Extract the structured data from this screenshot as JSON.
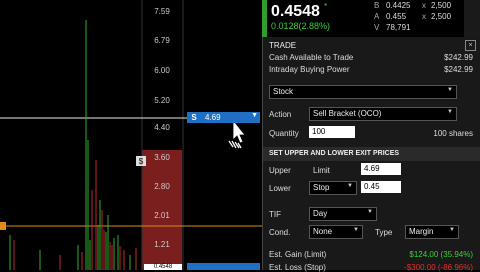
{
  "chart": {
    "y_ticks": [
      "7.59",
      "6.79",
      "6.00",
      "5.20",
      "4.40",
      "3.60",
      "2.80",
      "2.01",
      "1.21"
    ],
    "last_price_tag": "0.4548",
    "order_tag": {
      "side": "S",
      "price": "4.69"
    },
    "colors": {
      "up": "#2fae2f",
      "down": "#c22d2d",
      "accent": "#1f6fc5",
      "red_zone": "#7a1e1e"
    },
    "markers": [
      "$"
    ]
  },
  "quote": {
    "last": "0.4548",
    "star": "*",
    "change": "0.0128(2.88%)",
    "bid_label": "B",
    "bid": "0.4425",
    "bid_size": "2,500",
    "ask_label": "A",
    "ask": "0.455",
    "ask_size": "2,500",
    "vol_label": "V",
    "volume": "78,791",
    "size_sep": "x"
  },
  "trade": {
    "title": "TRADE",
    "close_icon": "×",
    "cash_label": "Cash Available to Trade",
    "cash_value": "$242.99",
    "bp_label": "Intraday Buying Power",
    "bp_value": "$242.99",
    "instrument": "Stock",
    "action_label": "Action",
    "action_value": "Sell Bracket (OCO)",
    "qty_label": "Quantity",
    "qty_value": "100",
    "qty_shares": "100 shares",
    "exit_header": "SET UPPER AND LOWER EXIT PRICES",
    "upper_label": "Upper",
    "upper_type": "Limit",
    "upper_price": "4.69",
    "lower_label": "Lower",
    "lower_type": "Stop",
    "lower_price": "0.45",
    "tif_label": "TIF",
    "tif_value": "Day",
    "cond_label": "Cond.",
    "cond_value": "None",
    "type_label": "Type",
    "type_value": "Margin",
    "est_gain_label": "Est. Gain (Limit)",
    "est_gain_value": "$124.00 (35.94%)",
    "est_loss_label": "Est. Loss (Stop)",
    "est_loss_value": "-$300.00 (-86.96%)"
  }
}
